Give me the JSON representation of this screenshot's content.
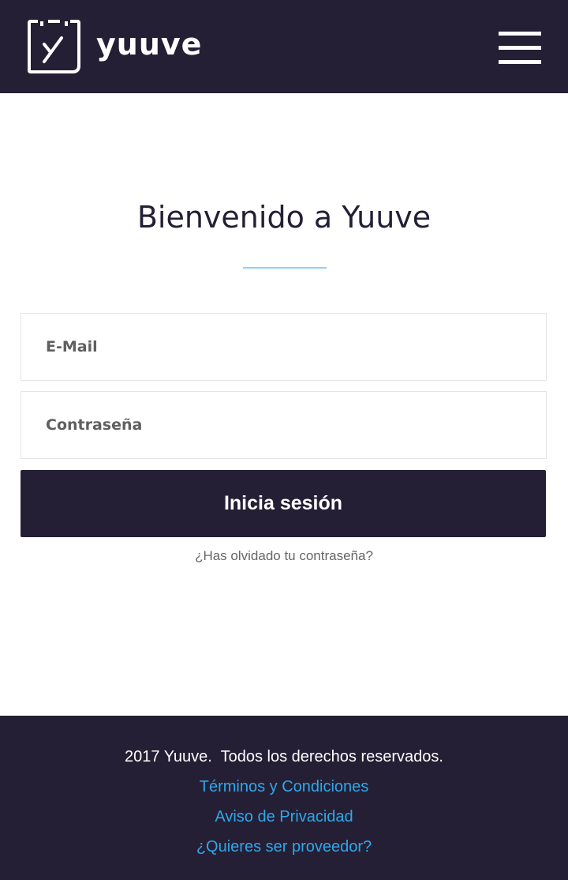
{
  "header": {
    "brand": "yuuve",
    "logo_icon": "calendar-check-icon",
    "menu_icon": "hamburger-menu-icon",
    "background": "#251f35"
  },
  "main": {
    "title": "Bienvenido a Yuuve",
    "divider_color": "#8fd0f2",
    "email": {
      "placeholder": "E-Mail",
      "value": ""
    },
    "password": {
      "placeholder": "Contraseña",
      "value": ""
    },
    "login_button": "Inicia sesión",
    "forgot_link": "¿Has olvidado tu contraseña?"
  },
  "footer": {
    "copyright": "2017 Yuuve.  Todos los derechos reservados.",
    "links": [
      "Términos y Condiciones",
      "Aviso de Privacidad",
      "¿Quieres ser proveedor?"
    ],
    "link_color": "#2fa7e9"
  }
}
